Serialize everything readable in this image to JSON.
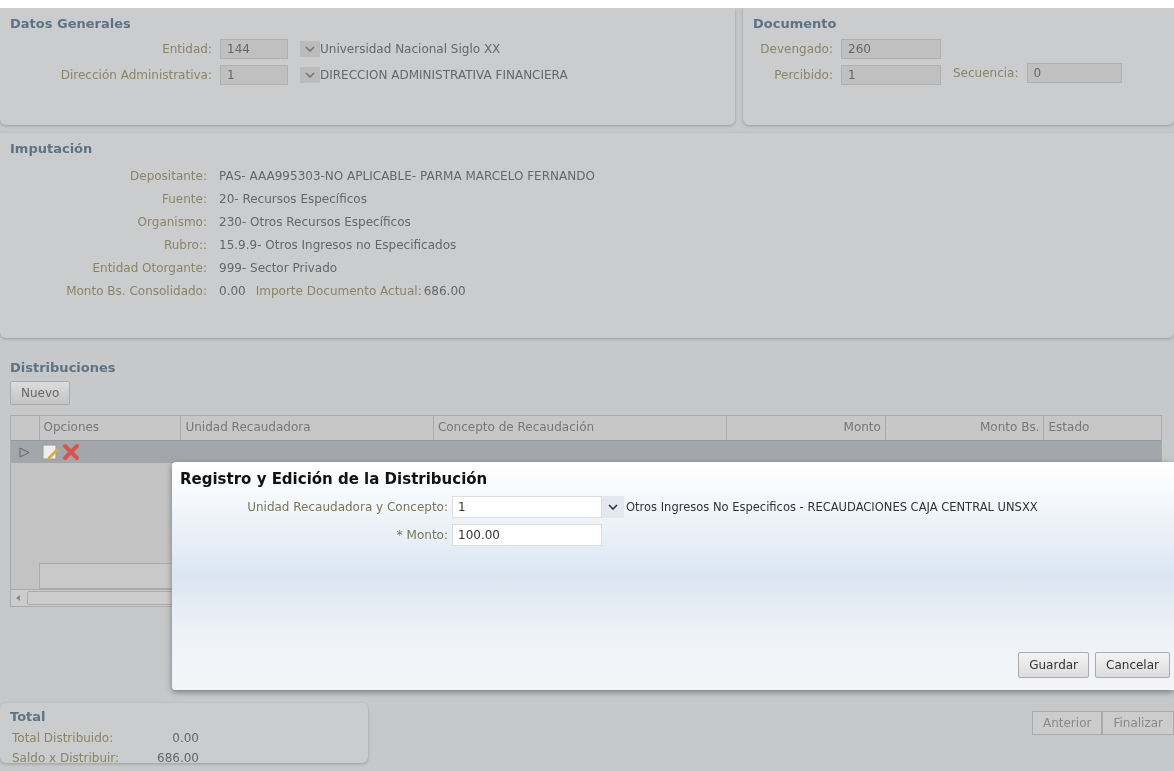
{
  "datos_generales": {
    "title": "Datos Generales",
    "fields": [
      {
        "label": "Entidad:",
        "value": "144",
        "description": "Universidad Nacional Siglo XX"
      },
      {
        "label": "Dirección Administrativa:",
        "value": "1",
        "description": "DIRECCION ADMINISTRATIVA FINANCIERA"
      }
    ]
  },
  "documento": {
    "title": "Documento",
    "devengado": {
      "label": "Devengado:",
      "value": "260"
    },
    "percibido": {
      "label": "Percibido:",
      "value": "1"
    },
    "secuencia": {
      "label": "Secuencia:",
      "value": "0"
    }
  },
  "imputacion": {
    "title": "Imputación",
    "rows": [
      {
        "label": "Depositante:",
        "value": "PAS-  AAA995303-NO APLICABLE-  PARMA MARCELO FERNANDO"
      },
      {
        "label": "Fuente:",
        "value": "20-  Recursos Específicos"
      },
      {
        "label": "Organismo:",
        "value": "230-  Otros Recursos Específicos"
      },
      {
        "label": "Rubro::",
        "value": "15.9.9-  Otros Ingresos no Especificados"
      },
      {
        "label": "Entidad Otorgante:",
        "value": "999-  Sector Privado"
      },
      {
        "label": "Monto Bs. Consolidado:",
        "value": "0.00",
        "extra_label": "Importe Documento Actual:",
        "extra_value": "686.00"
      }
    ]
  },
  "distribuciones": {
    "title": "Distribuciones",
    "new_button": "Nuevo",
    "columns": [
      "Opciones",
      "Unidad Recaudadora",
      "Concepto de Recaudación",
      "Monto",
      "Monto Bs.",
      "Estado"
    ],
    "rows": [
      {
        "selected": true
      }
    ]
  },
  "dialog": {
    "title": "Registro y Edición de la Distribución",
    "unidad_label": "Unidad Recaudadora y Concepto:",
    "unidad_value": "1",
    "unidad_description": "Otros Ingresos No Especificos - RECAUDACIONES CAJA CENTRAL UNSXX",
    "monto_label": "* Monto:",
    "monto_value": "100.00",
    "buttons": [
      "Guardar",
      "Cancelar"
    ]
  },
  "total": {
    "title": "Total",
    "rows": [
      {
        "label": "Total Distribuido:",
        "value": "0.00"
      },
      {
        "label": "Saldo x Distribuir:",
        "value": "686.00"
      }
    ]
  },
  "nav_buttons": [
    "Anterior",
    "Finalizar"
  ]
}
